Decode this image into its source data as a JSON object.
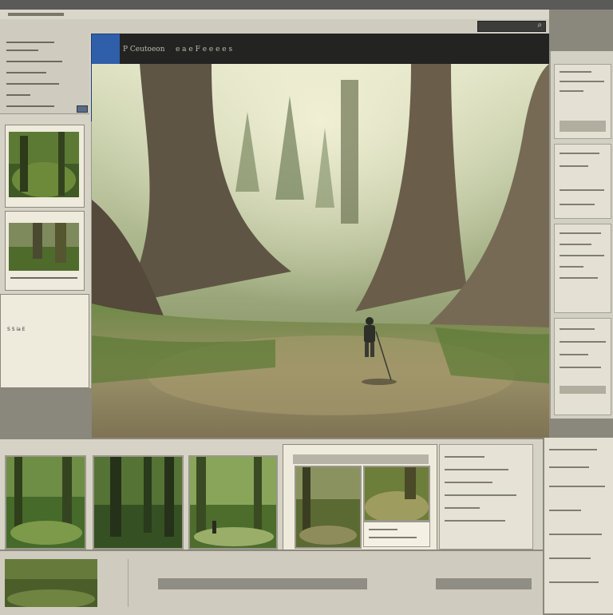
{
  "viewer": {
    "title_left": "P Ceutoeon",
    "title_right": "e a e  F e e e e s"
  },
  "left_panel": {
    "info_label": "S S ia  E"
  },
  "icons": {
    "search": "search-icon",
    "view_toggle": "view-toggle-icon"
  },
  "colors": {
    "accent_blue": "#2f5fa8",
    "chrome_dark": "#232322",
    "panel_beige": "#d6d3c6"
  }
}
